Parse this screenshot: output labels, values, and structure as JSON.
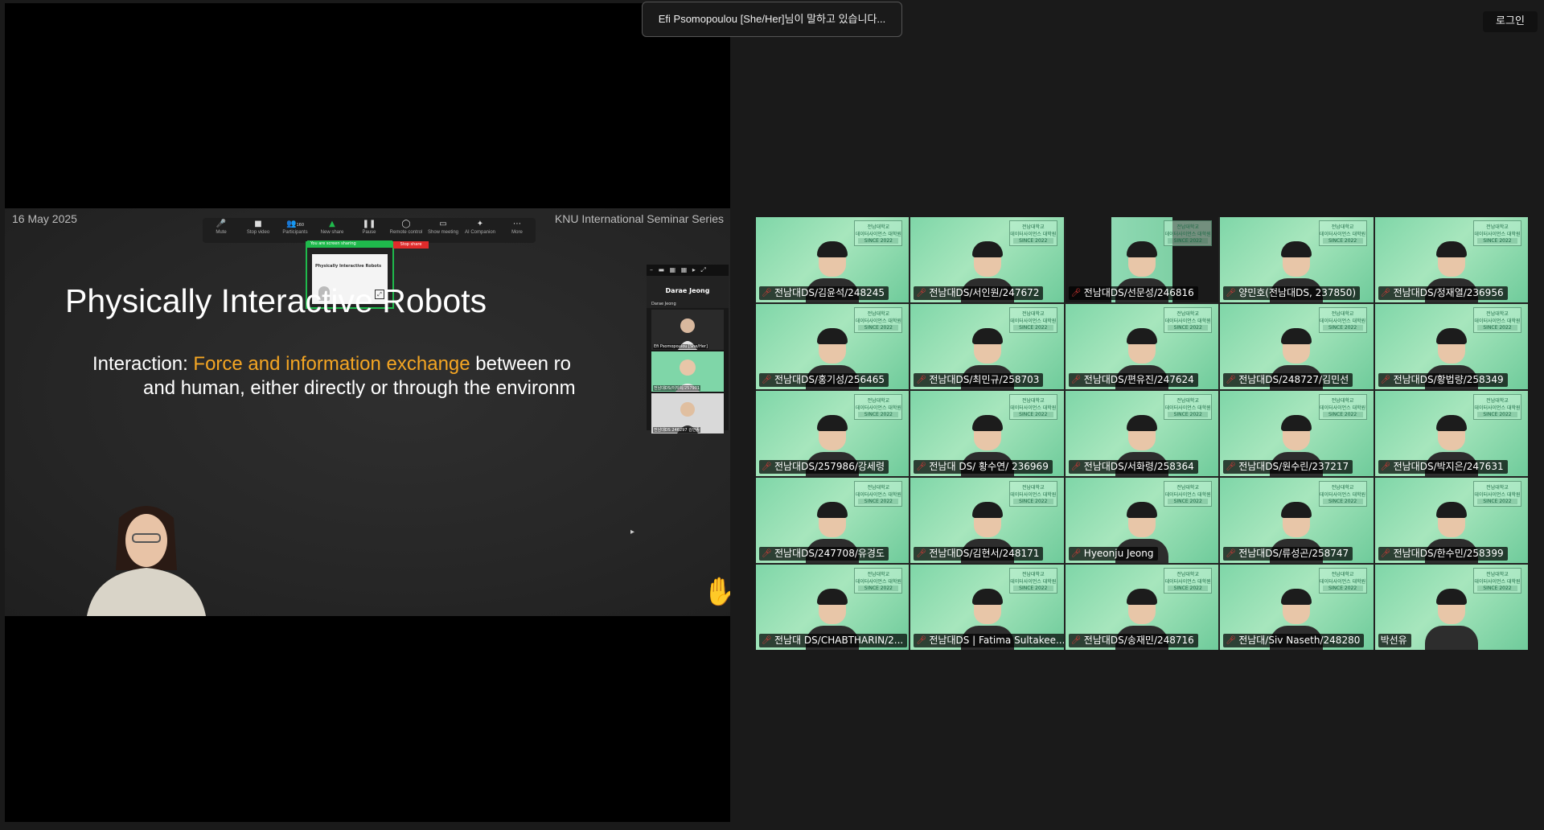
{
  "speaking_banner": "Efi Psomopoulou [She/Her]님이 말하고 있습니다...",
  "login_button": "로그인",
  "slide": {
    "date": "16 May 2025",
    "series": "KNU International Seminar Series",
    "title": "Physically Interactive Robots",
    "line1_pre": "Interaction: ",
    "line1_highlight": "Force and information exchange",
    "line1_post": " between ro",
    "line2": "and human, either directly or through the environm"
  },
  "zoom_toolbar": {
    "items": [
      {
        "label": "Mute",
        "icon": "microphone-icon"
      },
      {
        "label": "Stop video",
        "icon": "camera-icon"
      },
      {
        "label": "Participants",
        "icon": "participants-icon",
        "count": "160"
      },
      {
        "label": "New share",
        "icon": "share-icon"
      },
      {
        "label": "Pause",
        "icon": "pause-icon"
      },
      {
        "label": "Remote control",
        "icon": "remote-control-icon"
      },
      {
        "label": "Show meeting",
        "icon": "show-meeting-icon"
      },
      {
        "label": "AI Companion",
        "icon": "ai-companion-icon"
      },
      {
        "label": "More",
        "icon": "more-icon"
      }
    ],
    "sharing_notice": "You are screen sharing",
    "stop_share": "Stop share",
    "mini_slide_title": "Physically Interactive Robots"
  },
  "mini_panel": {
    "name_tile": "Darae Jeong",
    "name_tile_caption": "Darae Jeong",
    "tiles": [
      {
        "caption": "Efi Psomopoulou [She/Her]"
      },
      {
        "caption": "전남대DS/이지희/257901"
      },
      {
        "caption": "전남대DS 246297 김민종"
      }
    ]
  },
  "gallery": {
    "badge_line1": "전남대학교",
    "badge_line2": "데이터사이언스 대학원",
    "badge_line3": "SINCE 2022",
    "participants": [
      {
        "name": "전남대DS/김윤석/248245",
        "muted": true
      },
      {
        "name": "전남대DS/서인원/247672",
        "muted": true
      },
      {
        "name": "전남대DS/선문성/246816",
        "muted": true
      },
      {
        "name": "양민호(전남대DS, 237850)",
        "muted": true
      },
      {
        "name": "전남대DS/정재열/236956",
        "muted": true
      },
      {
        "name": "전남대DS/홍기성/256465",
        "muted": true
      },
      {
        "name": "전남대DS/최민규/258703",
        "muted": true
      },
      {
        "name": "전남대DS/편유진/247624",
        "muted": true
      },
      {
        "name": "전남대DS/248727/김민선",
        "muted": true
      },
      {
        "name": "전남대DS/황법량/258349",
        "muted": true
      },
      {
        "name": "전남대DS/257986/강세령",
        "muted": true
      },
      {
        "name": "전남대 DS/ 황수연/ 236969",
        "muted": true
      },
      {
        "name": "전남대DS/서화령/258364",
        "muted": true
      },
      {
        "name": "전남대DS/원수린/237217",
        "muted": true
      },
      {
        "name": "전남대DS/박지은/247631",
        "muted": true
      },
      {
        "name": "전남대DS/247708/유경도",
        "muted": true
      },
      {
        "name": "전남대DS/김현서/248171",
        "muted": true
      },
      {
        "name": "Hyeonju Jeong",
        "muted": true
      },
      {
        "name": "전남대DS/류성곤/258747",
        "muted": true
      },
      {
        "name": "전남대DS/한수민/258399",
        "muted": true
      },
      {
        "name": "전남대 DS/CHABTHARIN/2...",
        "muted": true
      },
      {
        "name": "전남대DS | Fatima Sultakee...",
        "muted": true
      },
      {
        "name": "전남대DS/송재민/248716",
        "muted": true
      },
      {
        "name": "전남대/Siv Naseth/248280",
        "muted": true
      },
      {
        "name": "박선유",
        "muted": false
      }
    ]
  }
}
